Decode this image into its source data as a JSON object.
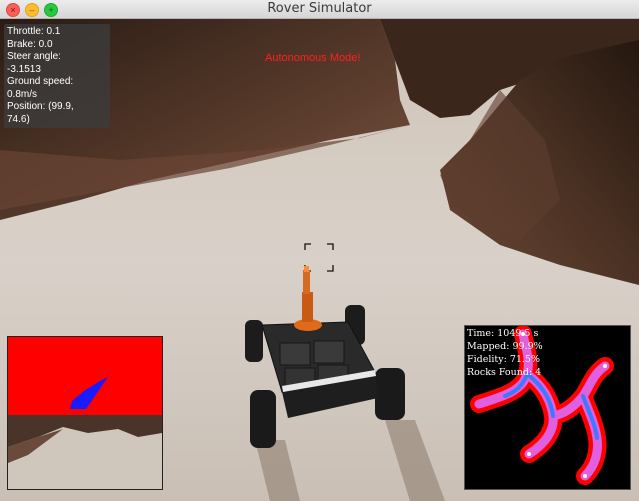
{
  "window": {
    "title": "Rover Simulator"
  },
  "controls": {
    "close": "×",
    "minimize": "–",
    "maximize": "+"
  },
  "telemetry": {
    "throttle": "Throttle: 0.1",
    "brake": "Brake: 0.0",
    "steer_label": "Steer angle:",
    "steer_value": "-3.1513",
    "speed_label": "Ground speed:",
    "speed_value": "0.8m/s",
    "position_label": "Position: (99.9,",
    "position_value": "74.6)"
  },
  "mode_text": "Autonomous Mode!",
  "map_stats": {
    "time": "Time: 1049.5 s",
    "mapped": "Mapped: 99.9%",
    "fidelity": "Fidelity: 71.5%",
    "rocks": "Rocks Found: 4"
  },
  "colors": {
    "mode_text": "#ff2020",
    "perspective_red": "#ff0000",
    "perspective_blue": "#1a1aff",
    "terrain_sand": "#d8d0c8",
    "wall_rock": "#4a3328"
  },
  "icons": [
    "close-icon",
    "minimize-icon",
    "maximize-icon",
    "crosshair-icon",
    "rover-icon"
  ]
}
